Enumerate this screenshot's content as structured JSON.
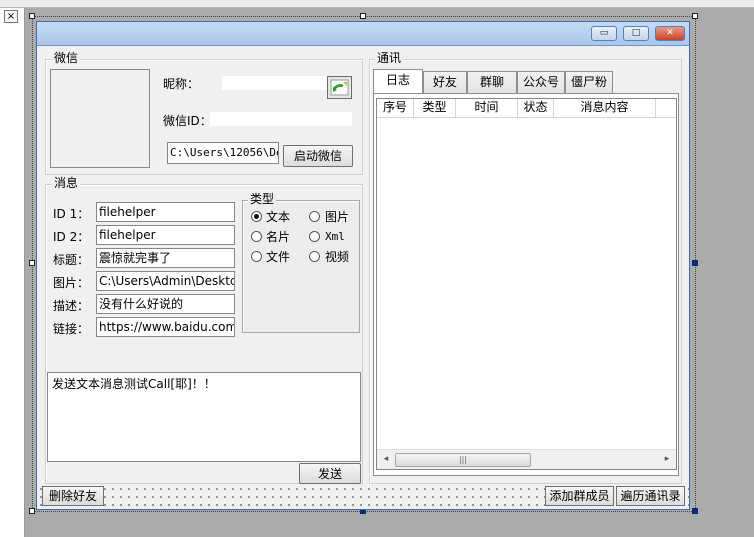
{
  "window": {
    "min_glyph": "▭",
    "max_glyph": "□",
    "close_glyph": "✕"
  },
  "ide": {
    "close_glyph": "×"
  },
  "wechat_group": {
    "title": "微信",
    "nickname_label": "昵称：",
    "wxid_label": "微信ID：",
    "path_value": "C:\\Users\\12056\\Des",
    "launch_button": "启动微信"
  },
  "message_group": {
    "title": "消息",
    "fields": [
      {
        "label": "ID 1：",
        "value": "filehelper"
      },
      {
        "label": "ID 2：",
        "value": "filehelper"
      },
      {
        "label": "标题：",
        "value": "震惊就完事了"
      },
      {
        "label": "图片：",
        "value": "C:\\Users\\Admin\\Desktc"
      },
      {
        "label": "描述：",
        "value": "没有什么好说的"
      },
      {
        "label": "链接：",
        "value": "https://www.baidu.com"
      }
    ],
    "type_group": {
      "title": "类型",
      "options": [
        {
          "label": "文本",
          "checked": true
        },
        {
          "label": "图片",
          "checked": false
        },
        {
          "label": "名片",
          "checked": false
        },
        {
          "label": "Xml",
          "checked": false
        },
        {
          "label": "文件",
          "checked": false
        },
        {
          "label": "视频",
          "checked": false
        }
      ]
    },
    "memo_text": "发送文本消息测试Call[耶]！！",
    "send_button": "发送"
  },
  "comm_group": {
    "title": "通讯",
    "tabs": [
      {
        "label": "日志",
        "active": true
      },
      {
        "label": "好友",
        "active": false
      },
      {
        "label": "群聊",
        "active": false
      },
      {
        "label": "公众号",
        "active": false
      },
      {
        "label": "僵尸粉",
        "active": false
      }
    ],
    "columns": [
      "序号",
      "类型",
      "时间",
      "状态",
      "消息内容"
    ],
    "scroll_left": "◂",
    "scroll_right": "▸",
    "scroll_grip": "|||"
  },
  "bottom": {
    "delete_friend": "删除好友",
    "add_members": "添加群成员",
    "traverse_contacts": "遍历通讯录"
  },
  "icons": {
    "refresh_icon": "green-arrow-refresh-icon"
  }
}
